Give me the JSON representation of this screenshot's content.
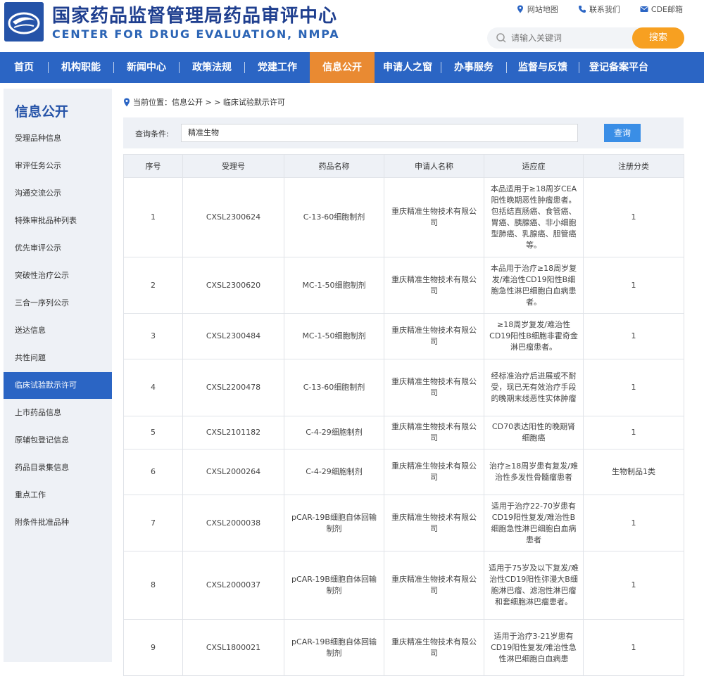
{
  "header": {
    "title_cn": "国家药品监督管理局药品审评中心",
    "title_en": "CENTER FOR DRUG EVALUATION, NMPA",
    "links": [
      "网站地图",
      "联系我们",
      "CDE邮箱"
    ],
    "search_placeholder": "请输入关键词",
    "search_button": "搜索"
  },
  "nav": {
    "items": [
      "首页",
      "机构职能",
      "新闻中心",
      "政策法规",
      "党建工作",
      "信息公开",
      "申请人之窗",
      "办事服务",
      "监督与反馈",
      "登记备案平台"
    ],
    "active": "信息公开"
  },
  "sidebar": {
    "title": "信息公开",
    "items": [
      "受理品种信息",
      "审评任务公示",
      "沟通交流公示",
      "特殊审批品种列表",
      "优先审评公示",
      "突破性治疗公示",
      "三合一序列公示",
      "送达信息",
      "共性问题",
      "临床试验默示许可",
      "上市药品信息",
      "原辅包登记信息",
      "药品目录集信息",
      "重点工作",
      "附条件批准品种"
    ],
    "active": "临床试验默示许可"
  },
  "breadcrumb": "当前位置：信息公开 > > 临床试验默示许可",
  "query": {
    "label": "查询条件:",
    "value": "精准生物",
    "button": "查询"
  },
  "table": {
    "headers": [
      "序号",
      "受理号",
      "药品名称",
      "申请人名称",
      "适应症",
      "注册分类"
    ],
    "rows": [
      [
        "1",
        "CXSL2300624",
        "C-13-60细胞制剂",
        "重庆精准生物技术有限公司",
        "本品适用于≥18周岁CEA阳性晚期恶性肿瘤患者。包括结直肠癌、食管癌、胃癌、胰腺癌、非小细胞型肺癌、乳腺癌、胆管癌等。",
        "1"
      ],
      [
        "2",
        "CXSL2300620",
        "MC-1-50细胞制剂",
        "重庆精准生物技术有限公司",
        "本品用于治疗≥18周岁复发/难治性CD19阳性B细胞急性淋巴细胞白血病患者。",
        "1"
      ],
      [
        "3",
        "CXSL2300484",
        "MC-1-50细胞制剂",
        "重庆精准生物技术有限公司",
        "≥18周岁复发/难治性CD19阳性B细胞非霍奇金淋巴瘤患者。",
        "1"
      ],
      [
        "4",
        "CXSL2200478",
        "C-13-60细胞制剂",
        "重庆精准生物技术有限公司",
        "经标准治疗后进展或不耐受，现已无有效治疗手段的晚期末线恶性实体肿瘤",
        "1"
      ],
      [
        "5",
        "CXSL2101182",
        "C-4-29细胞制剂",
        "重庆精准生物技术有限公司",
        "CD70表达阳性的晚期肾细胞癌",
        "1"
      ],
      [
        "6",
        "CXSL2000264",
        "C-4-29细胞制剂",
        "重庆精准生物技术有限公司",
        "治疗≥18周岁患有复发/难治性多发性骨髓瘤患者",
        "生物制品1类"
      ],
      [
        "7",
        "CXSL2000038",
        "pCAR-19B细胞自体回输制剂",
        "重庆精准生物技术有限公司",
        "适用于治疗22-70岁患有CD19阳性复发/难治性B细胞急性淋巴细胞白血病患者",
        "1"
      ],
      [
        "8",
        "CXSL2000037",
        "pCAR-19B细胞自体回输制剂",
        "重庆精准生物技术有限公司",
        "适用于75岁及以下复发/难治性CD19阳性弥漫大B细胞淋巴瘤、滤泡性淋巴瘤和套细胞淋巴瘤患者。",
        "1"
      ],
      [
        "9",
        "CXSL1800021",
        "pCAR-19B细胞自体回输制剂",
        "重庆精准生物技术有限公司",
        "适用于治疗3-21岁患有CD19阳性复发/难治性急性淋巴细胞白血病患",
        "1"
      ]
    ]
  },
  "colors": {
    "nav_bg": "#2b65c4",
    "nav_active": "#e98a32",
    "search_button": "#f7a021",
    "query_button": "#3a8ee6",
    "title": "#1f3f8f"
  }
}
